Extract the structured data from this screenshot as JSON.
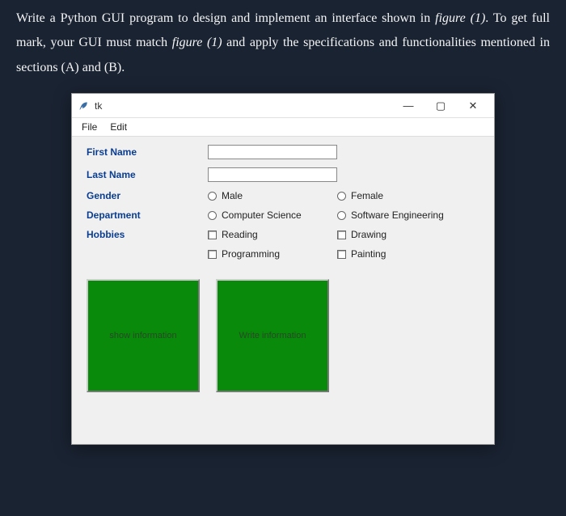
{
  "instruction": {
    "part1": "Write a Python GUI program to design and implement an interface shown in ",
    "fig1a": "figure (1)",
    "part2": ". To get full mark, your GUI must match ",
    "fig1b": "figure (1)",
    "part3": " and apply the specifications and functionalities mentioned in sections (A) and (B)."
  },
  "window": {
    "title": "tk",
    "controls": {
      "min": "—",
      "max": "▢",
      "close": "✕"
    }
  },
  "menu": {
    "file": "File",
    "edit": "Edit"
  },
  "form": {
    "first_name_label": "First Name",
    "first_name_value": "",
    "last_name_label": "Last Name",
    "last_name_value": "",
    "gender_label": "Gender",
    "gender_opt1": "Male",
    "gender_opt2": "Female",
    "dept_label": "Department",
    "dept_opt1": "Computer Science",
    "dept_opt2": "Software Engineering",
    "hobbies_label": "Hobbies",
    "hobby1": "Reading",
    "hobby2": "Drawing",
    "hobby3": "Programming",
    "hobby4": "Painting"
  },
  "buttons": {
    "show": "show information",
    "write": "Write information"
  }
}
